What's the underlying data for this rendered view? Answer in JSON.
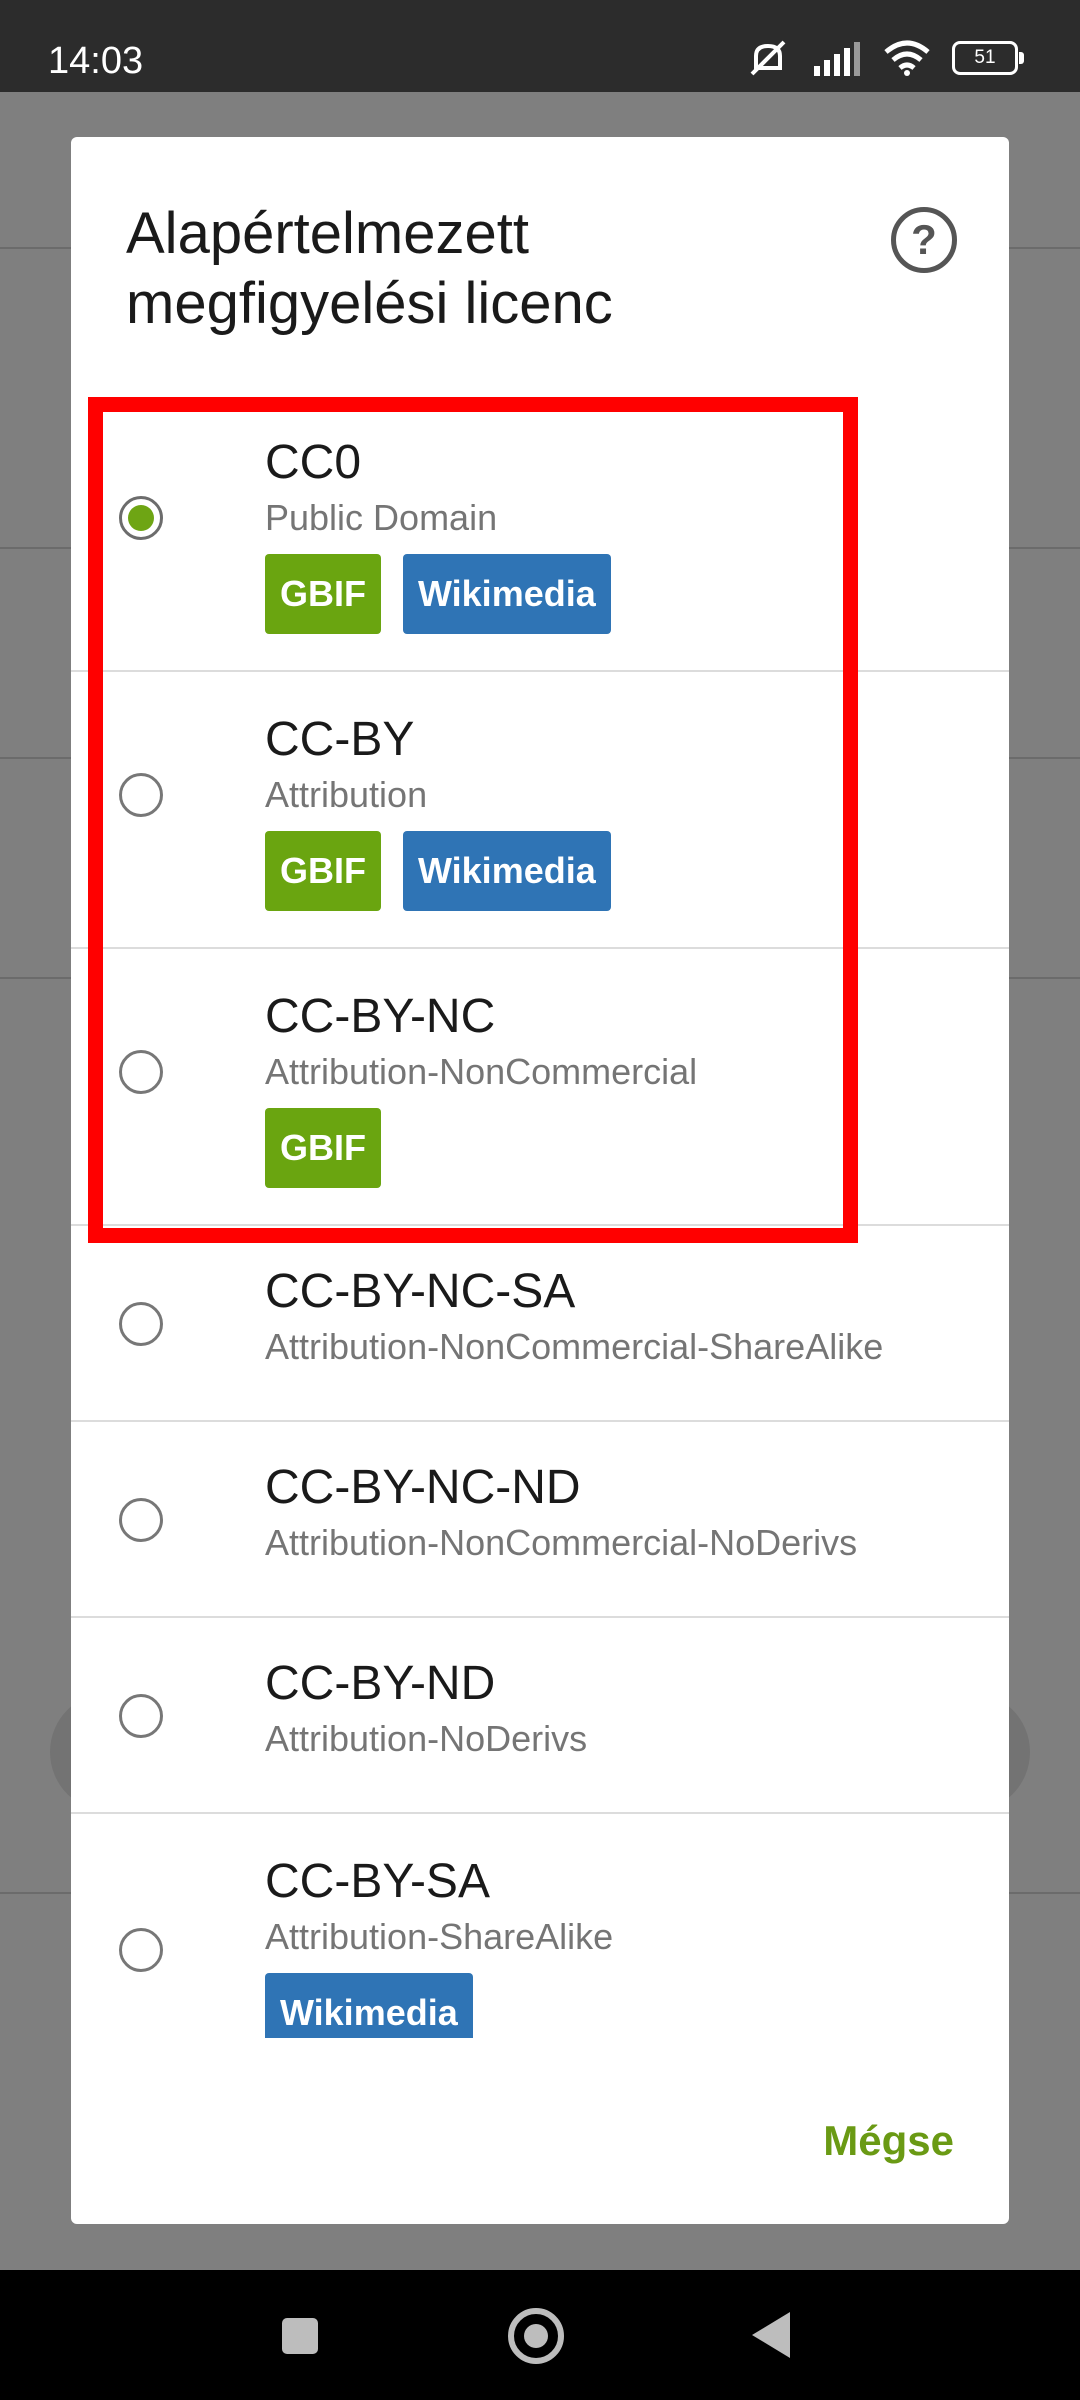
{
  "status_bar": {
    "time": "14:03",
    "battery": "51"
  },
  "dialog": {
    "title": "Alapértelmezett megfigyelési licenc",
    "cancel_label": "Mégse",
    "options": [
      {
        "title": "CC0",
        "subtitle": "Public Domain",
        "selected": true,
        "badges": [
          "GBIF",
          "Wikimedia"
        ]
      },
      {
        "title": "CC-BY",
        "subtitle": "Attribution",
        "selected": false,
        "badges": [
          "GBIF",
          "Wikimedia"
        ]
      },
      {
        "title": "CC-BY-NC",
        "subtitle": "Attribution-NonCommercial",
        "selected": false,
        "badges": [
          "GBIF"
        ]
      },
      {
        "title": "CC-BY-NC-SA",
        "subtitle": "Attribution-NonCommercial-ShareAlike",
        "selected": false,
        "badges": []
      },
      {
        "title": "CC-BY-NC-ND",
        "subtitle": "Attribution-NonCommercial-NoDerivs",
        "selected": false,
        "badges": []
      },
      {
        "title": "CC-BY-ND",
        "subtitle": "Attribution-NoDerivs",
        "selected": false,
        "badges": []
      },
      {
        "title": "CC-BY-SA",
        "subtitle": "Attribution-ShareAlike",
        "selected": false,
        "badges": [
          "Wikimedia"
        ]
      }
    ]
  },
  "colors": {
    "accent": "#6aa510",
    "wikimedia": "#2f74b5",
    "highlight": "#ff0000"
  }
}
